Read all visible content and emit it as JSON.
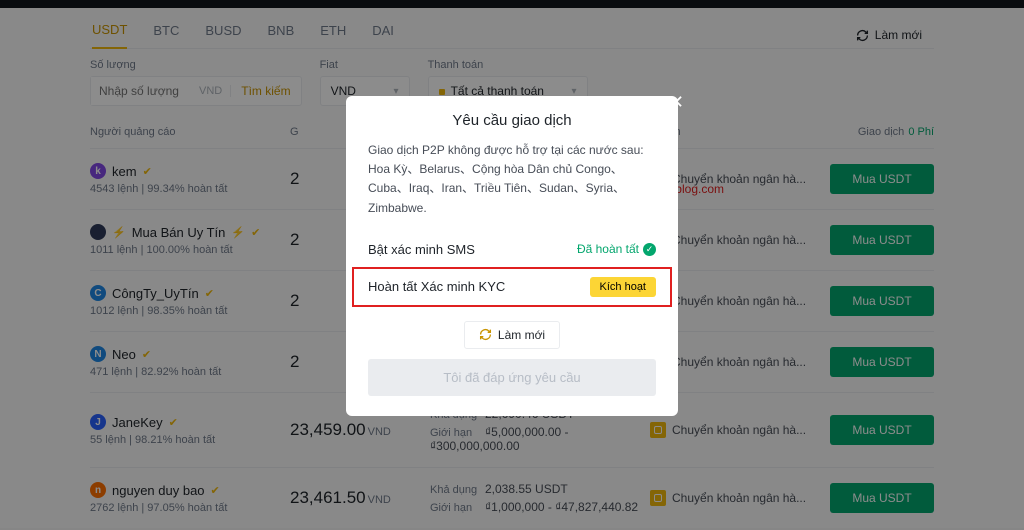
{
  "tabs": [
    "USDT",
    "BTC",
    "BUSD",
    "BNB",
    "ETH",
    "DAI"
  ],
  "refresh_label": "Làm mới",
  "filters": {
    "amount_label": "Số lượng",
    "amount_placeholder": "Nhập số lượng",
    "amount_currency": "VND",
    "search_label": "Tìm kiếm",
    "fiat_label": "Fiat",
    "fiat_value": "VND",
    "payment_label": "Thanh toán",
    "payment_value": "Tất cả thanh toán"
  },
  "headers": {
    "advertiser": "Người quảng cáo",
    "price": "G",
    "limit": "",
    "method": "h toán",
    "trade": "Giao dịch",
    "zero_fee": "0 Phí"
  },
  "labels": {
    "available": "Khả dụng",
    "limit": "Giới hạn"
  },
  "rows": [
    {
      "avatar_bg": "#8247e5",
      "initial": "k",
      "name": "kem",
      "verified": true,
      "bolt": false,
      "meta": "4543 lệnh   |   99.34% hoàn tất",
      "price": "2",
      "unit": "",
      "avail": "",
      "limit": "",
      "method": "Chuyển khoản ngân hà...",
      "buy": "Mua USDT"
    },
    {
      "avatar_bg": "#2e3a59",
      "initial": "",
      "name": "Mua Bán Uy Tín",
      "verified": true,
      "bolt": true,
      "meta": "1011 lệnh   |   100.00% hoàn tất",
      "price": "2",
      "unit": "",
      "avail": "",
      "limit": "",
      "method": "Chuyển khoản ngân hà...",
      "buy": "Mua USDT"
    },
    {
      "avatar_bg": "#1e88e5",
      "initial": "C",
      "name": "CôngTy_UyTín",
      "verified": true,
      "bolt": false,
      "meta": "1012 lệnh   |   98.35% hoàn tất",
      "price": "2",
      "unit": "",
      "avail": "",
      "limit": "",
      "method": "Chuyển khoản ngân hà...",
      "buy": "Mua USDT"
    },
    {
      "avatar_bg": "#1e88e5",
      "initial": "N",
      "name": "Neo",
      "verified": true,
      "bolt": false,
      "meta": "471 lệnh   |   82.92% hoàn tất",
      "price": "2",
      "unit": "",
      "avail": "",
      "limit": "",
      "method": "Chuyển khoản ngân hà...",
      "buy": "Mua USDT"
    },
    {
      "avatar_bg": "#2962ff",
      "initial": "J",
      "name": "JaneKey",
      "verified": true,
      "bolt": false,
      "meta": "55 lệnh   |   98.21% hoàn tất",
      "price": "23,459.00",
      "unit": "VND",
      "avail": "22,690.46 USDT",
      "limit": "₫5,000,000.00 - ₫300,000,000.00",
      "method": "Chuyển khoản ngân hà...",
      "buy": "Mua USDT"
    },
    {
      "avatar_bg": "#ff6f00",
      "initial": "n",
      "name": "nguyen duy bao",
      "verified": true,
      "bolt": false,
      "meta": "2762 lệnh   |   97.05% hoàn tất",
      "price": "23,461.50",
      "unit": "VND",
      "avail": "2,038.55 USDT",
      "limit": "₫1,000,000 - ₫47,827,440.82",
      "method": "Chuyển khoản ngân hà...",
      "buy": "Mua USDT"
    }
  ],
  "modal": {
    "title": "Yêu cầu giao dịch",
    "desc": "Giao dịch P2P không được hỗ trợ tại các nước sau: Hoa Kỳ、Belarus、Cộng hòa Dân chủ Congo、Cuba、Iraq、Iran、Triều Tiên、Sudan、Syria、Zimbabwe.",
    "sms_label": "Bật xác minh SMS",
    "sms_status": "Đã hoàn tất",
    "kyc_label": "Hoàn tất Xác minh KYC",
    "kyc_action": "Kích hoạt",
    "refresh": "Làm mới",
    "confirm": "Tôi đã đáp ứng yêu cầu"
  },
  "watermark": "kiemtienblog.com"
}
